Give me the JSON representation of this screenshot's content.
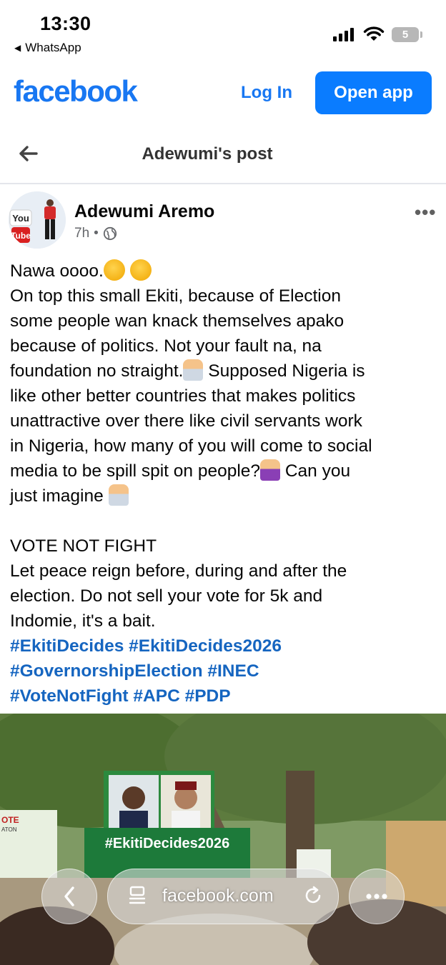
{
  "status_bar": {
    "time": "13:30",
    "back_app": "WhatsApp",
    "battery": "5"
  },
  "header": {
    "logo": "facebook",
    "login": "Log In",
    "open_app": "Open app"
  },
  "nav": {
    "title": "Adewumi's post"
  },
  "post": {
    "author": "Adewumi Aremo",
    "time": "7h",
    "separator": "•",
    "avatar_text": [
      "You",
      "Tube"
    ],
    "lines": {
      "l1": "Nawa oooo.",
      "l2": "On top this small Ekiti, because of Election",
      "l3": "some people wan knack themselves apako",
      "l4": "because of politics. Not your fault na, na",
      "l5": "foundation no straight.",
      "l5b": " Supposed Nigeria is",
      "l6": "like other better countries that makes politics",
      "l7": "unattractive over there like civil servants work",
      "l8": "in Nigeria, how many of you will come to social",
      "l9": "media to be spill spit on people?",
      "l9b": " Can you",
      "l10": "just imagine "
    },
    "paragraph2": {
      "l1": "VOTE NOT FIGHT",
      "l2": "Let peace reign before, during and after the",
      "l3": "election. Do not sell your vote for 5k and",
      "l4": "Indomie, it's a bait."
    },
    "hashtags": [
      "#EkitiDecides",
      "#EkitiDecides2026",
      "#GovernorshipElection",
      "#INEC",
      "#VoteNotFight",
      "#APC",
      "#PDP"
    ],
    "photo_text": {
      "banner": "#EkitiDecides2026",
      "sign": "OTE",
      "sign2": "ATON"
    }
  },
  "browser": {
    "url": "facebook.com"
  },
  "colors": {
    "brand": "#1877f2",
    "button": "#0a7cff",
    "hashtag": "#1565c0",
    "meta": "#65676b"
  }
}
